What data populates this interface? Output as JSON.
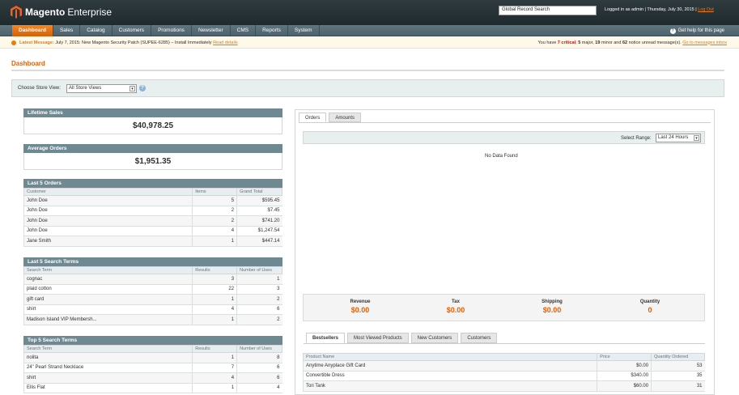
{
  "header": {
    "logo_brand": "Magento",
    "logo_edition": "Enterprise",
    "global_search_value": "Global Record Search",
    "logged_in": "Logged in as admin",
    "date": "Thursday, July 30, 2015",
    "logout": "Log Out"
  },
  "nav": {
    "items": [
      "Dashboard",
      "Sales",
      "Catalog",
      "Customers",
      "Promotions",
      "Newsletter",
      "CMS",
      "Reports",
      "System"
    ],
    "help": "Get help for this page"
  },
  "message": {
    "latest_label": "Latest Message:",
    "latest_text": "July 7, 2015: New Magento Security Patch (SUPEE-6285) – Install Immediately",
    "read_details": "Read details",
    "summary_prefix": "You have",
    "critical": "7 critical",
    "major": "5",
    "major_label": "major,",
    "minor": "19",
    "minor_label": "minor and",
    "notice": "62",
    "notice_label": "notice unread message(s).",
    "go_inbox": "Go to messages inbox"
  },
  "page": {
    "title": "Dashboard"
  },
  "store_switcher": {
    "label": "Choose Store View:",
    "value": "All Store Views"
  },
  "lifetime_sales": {
    "label": "Lifetime Sales",
    "value": "$40,978.25"
  },
  "average_orders": {
    "label": "Average Orders",
    "value": "$1,951.35"
  },
  "last_orders": {
    "title": "Last 5 Orders",
    "columns": [
      "Customer",
      "Items",
      "Grand Total"
    ],
    "rows": [
      [
        "John Doe",
        "5",
        "$595.45"
      ],
      [
        "John Doe",
        "2",
        "$7.45"
      ],
      [
        "John Doe",
        "2",
        "$741.20"
      ],
      [
        "John Doe",
        "4",
        "$1,247.54"
      ],
      [
        "Jane Smith",
        "1",
        "$447.14"
      ]
    ]
  },
  "last_search": {
    "title": "Last 5 Search Terms",
    "columns": [
      "Search Term",
      "Results",
      "Number of Uses"
    ],
    "rows": [
      [
        "cognac",
        "3",
        "1"
      ],
      [
        "plaid cotton",
        "22",
        "3"
      ],
      [
        "gift card",
        "1",
        "2"
      ],
      [
        "shirt",
        "4",
        "6"
      ],
      [
        "Madison Island VIP Membersh...",
        "1",
        "2"
      ]
    ]
  },
  "top_search": {
    "title": "Top 5 Search Terms",
    "columns": [
      "Search Term",
      "Results",
      "Number of Uses"
    ],
    "rows": [
      [
        "nolita",
        "1",
        "8"
      ],
      [
        "24\" Pearl Strand Necklace",
        "7",
        "6"
      ],
      [
        "shirt",
        "4",
        "6"
      ],
      [
        "Ellis Flat",
        "1",
        "4"
      ]
    ]
  },
  "chart_tabs": [
    "Orders",
    "Amounts"
  ],
  "range": {
    "label": "Select Range:",
    "value": "Last 24 Hours"
  },
  "no_data": "No Data Found",
  "totals": [
    {
      "label": "Revenue",
      "value": "$0.00"
    },
    {
      "label": "Tax",
      "value": "$0.00"
    },
    {
      "label": "Shipping",
      "value": "$0.00"
    },
    {
      "label": "Quantity",
      "value": "0"
    }
  ],
  "grid_tabs": [
    "Bestsellers",
    "Most Viewed Products",
    "New Customers",
    "Customers"
  ],
  "bestsellers": {
    "columns": [
      "Product Name",
      "Price",
      "Quantity Ordered"
    ],
    "rows": [
      [
        "Anytime Anyplace Gift Card",
        "$0.00",
        "53"
      ],
      [
        "Convertible Dress",
        "$340.00",
        "35"
      ],
      [
        "Tori Tank",
        "$60.00",
        "31"
      ]
    ]
  },
  "colors": {
    "accent": "#eb5e00",
    "header_bg": "#2f3b3f",
    "nav_bg": "#5f7680",
    "box_head": "#6f8992"
  }
}
